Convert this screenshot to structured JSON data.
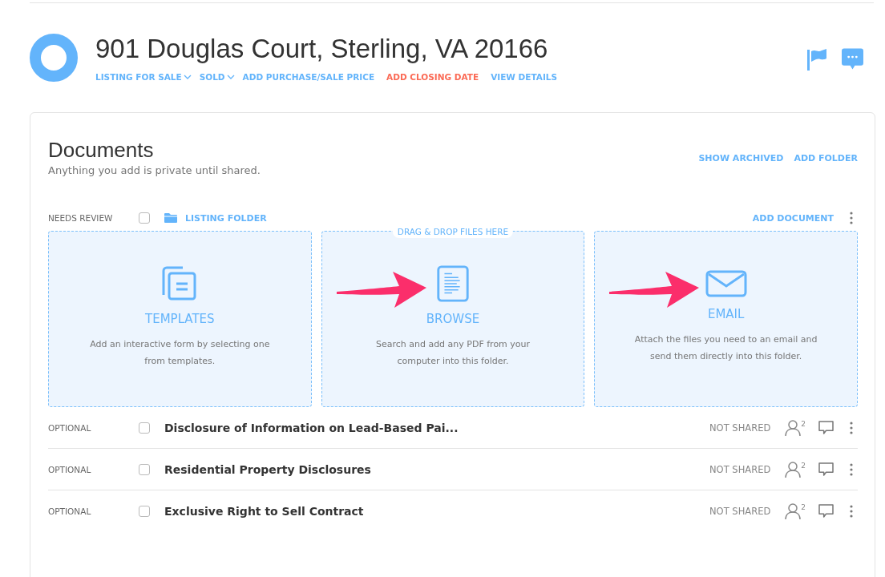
{
  "property": {
    "title": "901 Douglas Court, Sterling, VA 20166",
    "links": [
      {
        "label": "LISTING FOR SALE",
        "kind": "dropdown"
      },
      {
        "label": "SOLD",
        "kind": "dropdown"
      },
      {
        "label": "ADD PURCHASE/SALE PRICE",
        "kind": "link"
      },
      {
        "label": "ADD CLOSING DATE",
        "kind": "alert"
      },
      {
        "label": "VIEW DETAILS",
        "kind": "link"
      }
    ]
  },
  "documents": {
    "title": "Documents",
    "subtitle": "Anything you add is private until shared.",
    "actions": [
      "SHOW ARCHIVED",
      "ADD FOLDER"
    ],
    "folder": {
      "status": "NEEDS REVIEW",
      "checked": false,
      "name": "LISTING FOLDER",
      "action": "ADD DOCUMENT"
    },
    "drop_hint": "DRAG & DROP FILES HERE",
    "tiles": [
      {
        "kind": "templates",
        "title": "TEMPLATES",
        "text": "Add an interactive form by selecting one from templates.",
        "annotated": false
      },
      {
        "kind": "browse",
        "title": "BROWSE",
        "text": "Search and add any PDF from your computer into this folder.",
        "annotated": true
      },
      {
        "kind": "email",
        "title": "EMAIL",
        "text": "Attach the files you need to an email and send them directly into this folder.",
        "annotated": true
      }
    ],
    "rows": [
      {
        "status": "OPTIONAL",
        "checked": false,
        "name": "Disclosure of Information on Lead-Based Pai...",
        "sharing": "NOT SHARED",
        "signers": "2"
      },
      {
        "status": "OPTIONAL",
        "checked": false,
        "name": "Residential Property Disclosures",
        "sharing": "NOT SHARED",
        "signers": "2"
      },
      {
        "status": "OPTIONAL",
        "checked": false,
        "name": "Exclusive Right to Sell Contract",
        "sharing": "NOT SHARED",
        "signers": "2"
      }
    ]
  }
}
